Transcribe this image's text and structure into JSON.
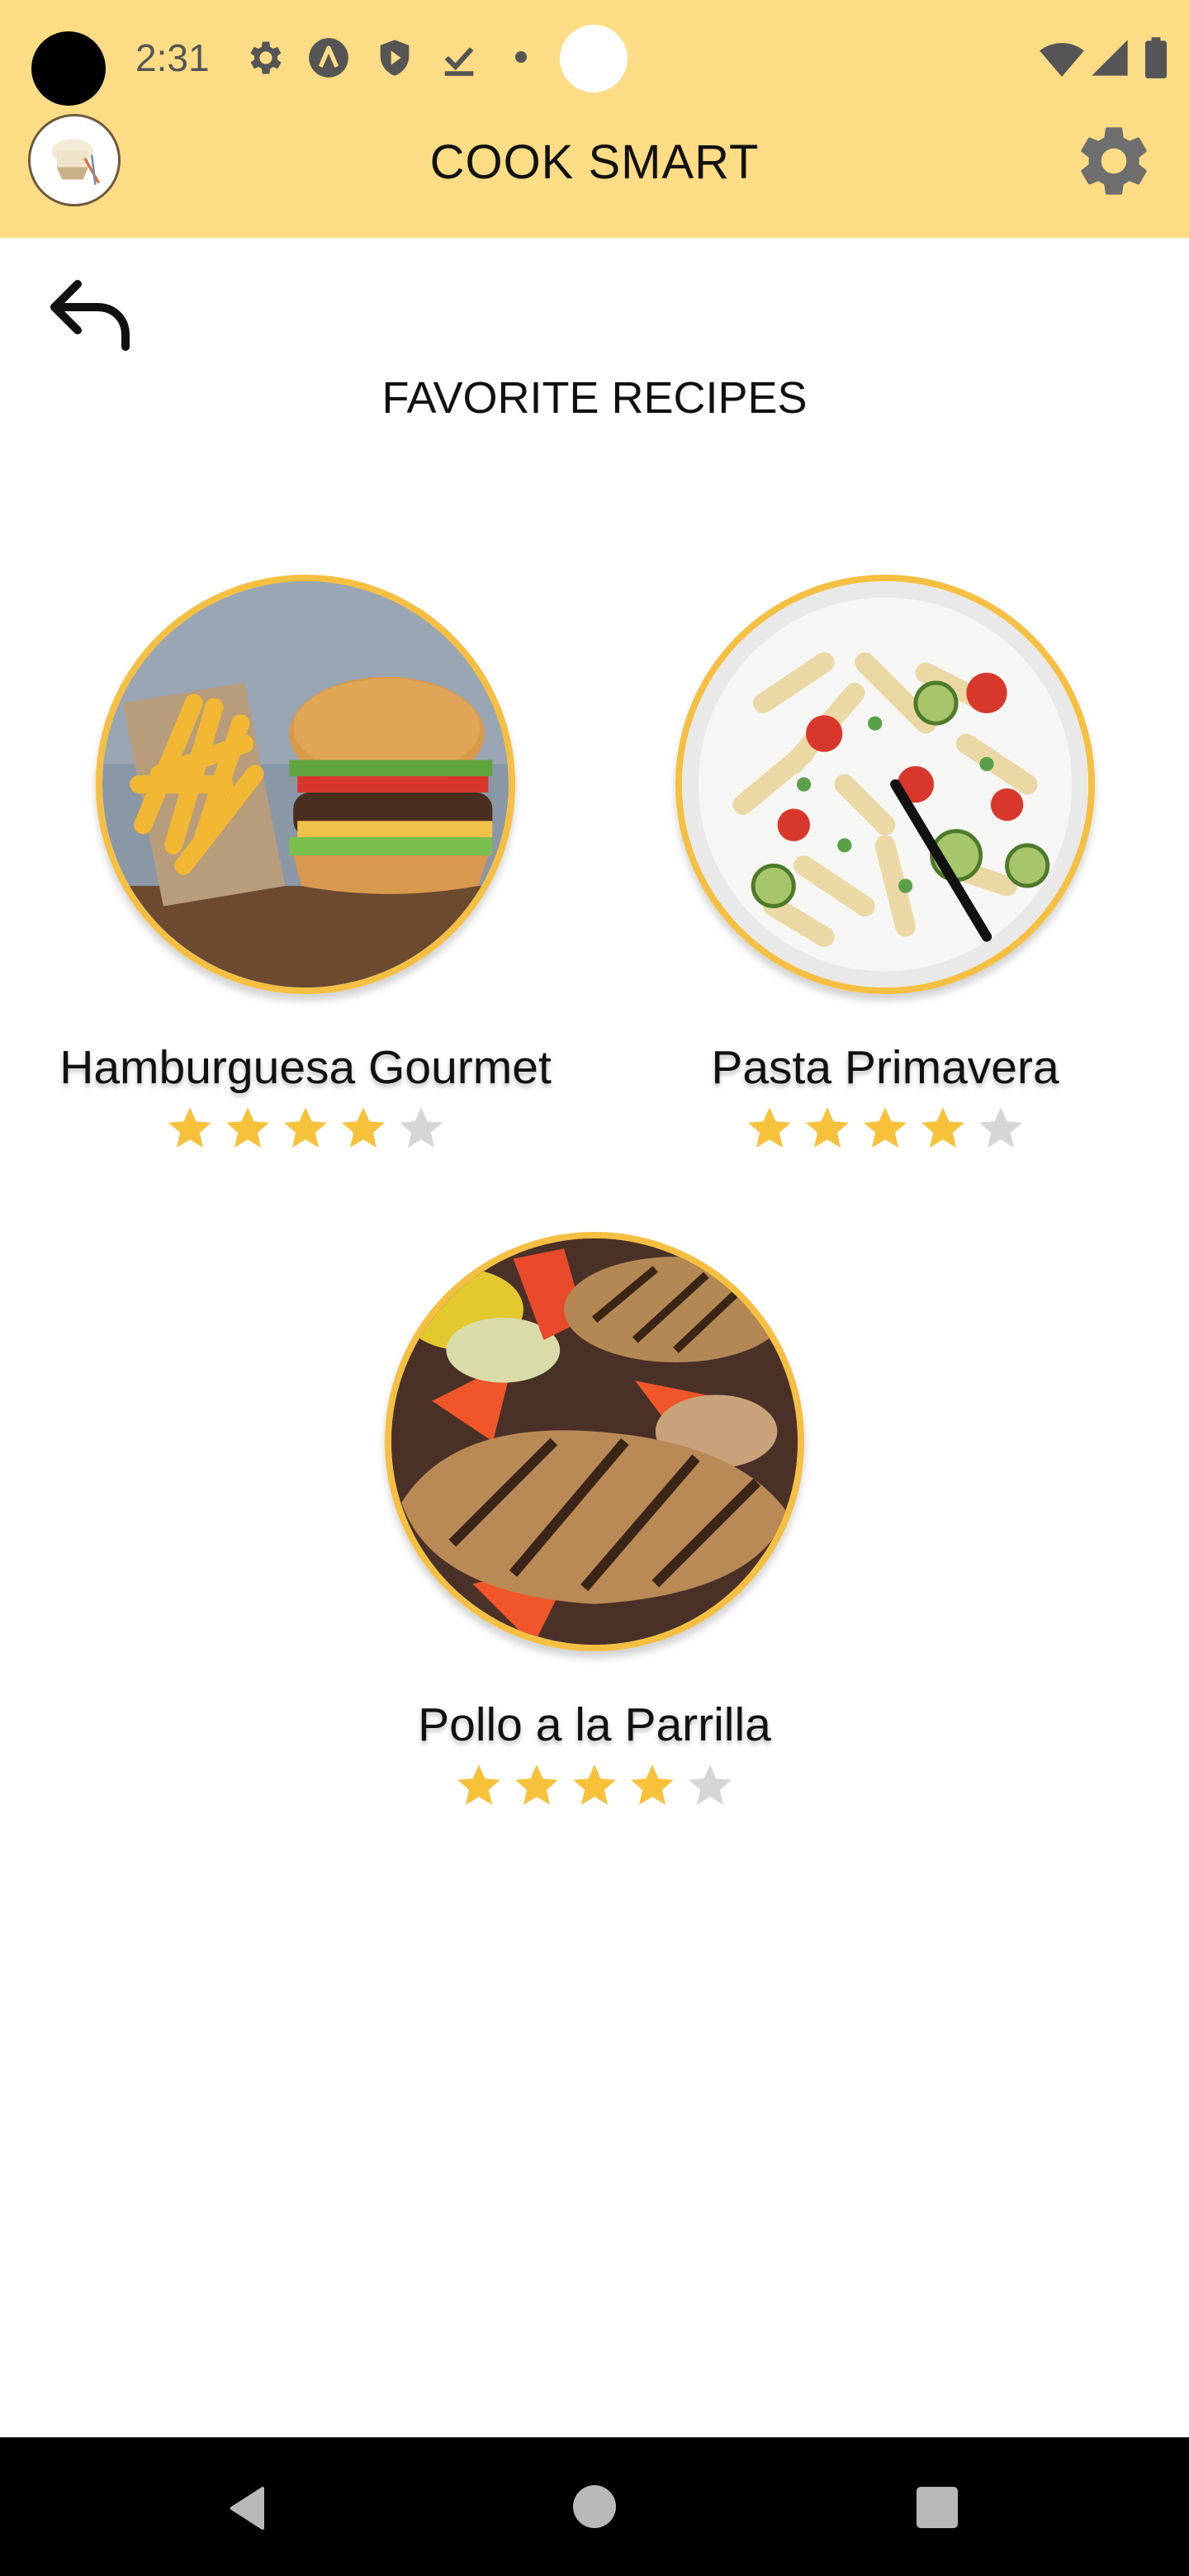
{
  "status_bar": {
    "time": "2:31",
    "icons": [
      "settings-icon",
      "android-a-icon",
      "shield-icon",
      "download-done-icon",
      "notification-dot",
      "wifi-icon",
      "signal-icon",
      "battery-icon"
    ]
  },
  "app_bar": {
    "title": "COOK SMART",
    "logo_icon": "chef-hat-logo",
    "settings_icon": "gear-icon"
  },
  "page": {
    "back_icon": "undo-arrow-icon",
    "title": "FAVORITE RECIPES"
  },
  "recipes": [
    {
      "name": "Hamburguesa Gourmet",
      "rating": 4,
      "max_rating": 5,
      "image": "burger-and-fries-photo"
    },
    {
      "name": "Pasta Primavera",
      "rating": 4,
      "max_rating": 5,
      "image": "pasta-salad-photo"
    },
    {
      "name": "Pollo a la Parrilla",
      "rating": 4,
      "max_rating": 5,
      "image": "grilled-chicken-photo"
    }
  ],
  "colors": {
    "header": "#fcdc84",
    "photo_border": "#f5bf42",
    "star_filled": "#f7c13a",
    "star_empty": "#d6d6d6"
  },
  "nav_bar": {
    "icons": [
      "back-triangle-icon",
      "home-circle-icon",
      "recents-square-icon"
    ]
  }
}
